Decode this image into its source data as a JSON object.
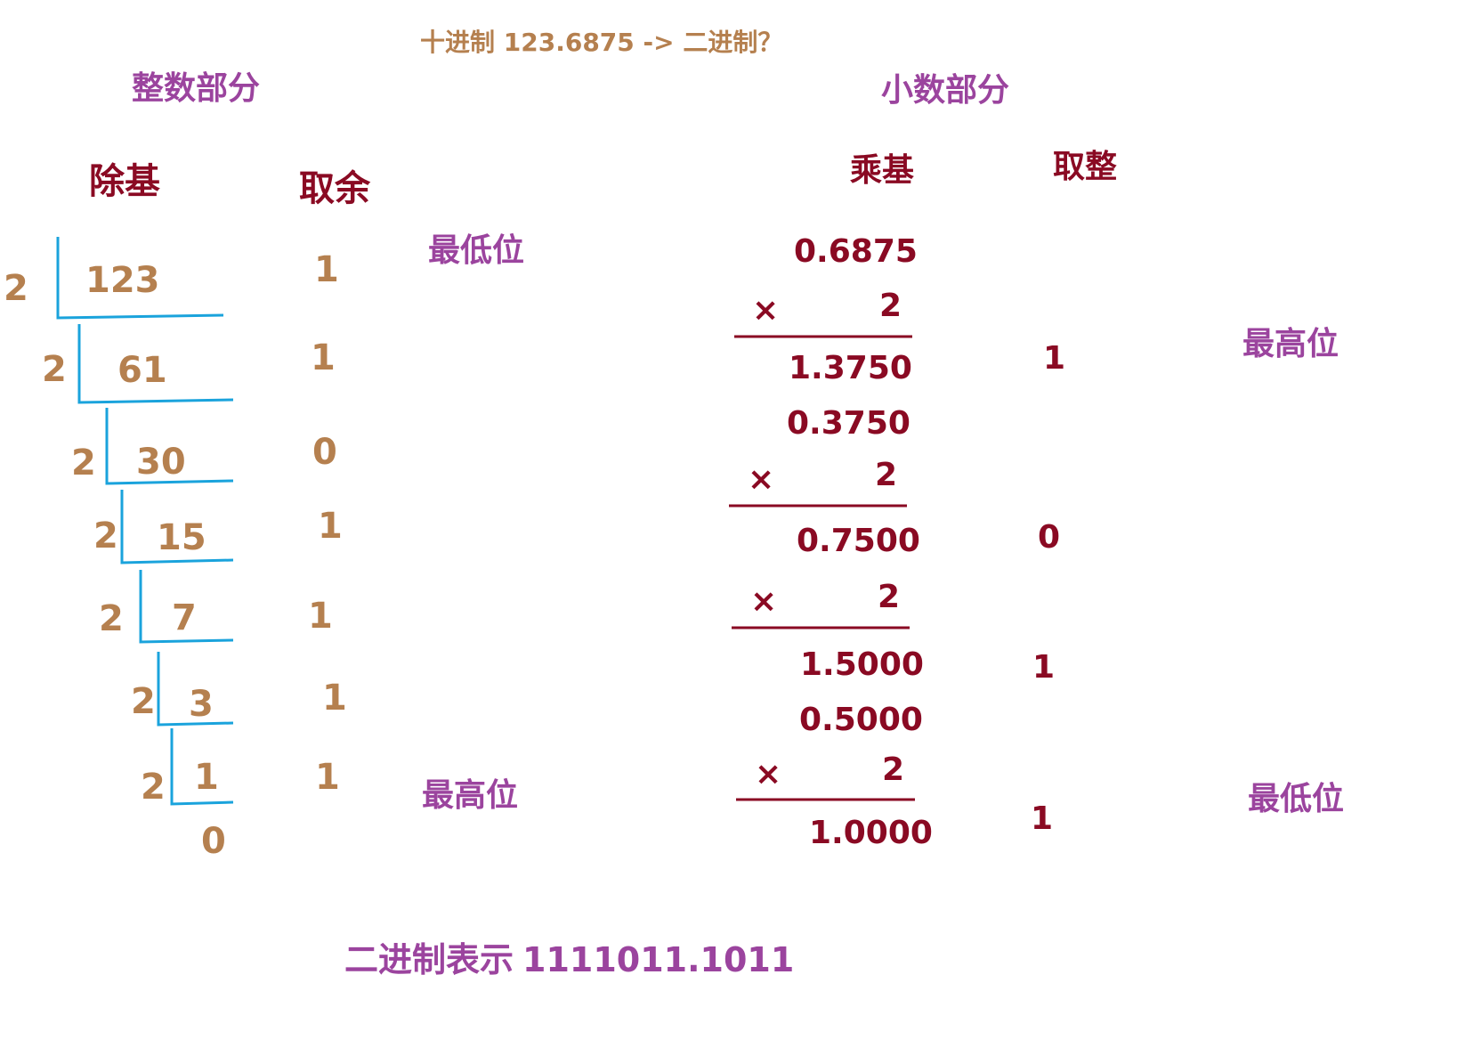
{
  "title": "十进制 123.6875 -> 二进制？",
  "integer_part": {
    "heading": "整数部分",
    "col_divide": "除基",
    "col_remainder": "取余",
    "steps": [
      {
        "divisor": "2",
        "dividend": "123",
        "remainder": "1"
      },
      {
        "divisor": "2",
        "dividend": "61",
        "remainder": "1"
      },
      {
        "divisor": "2",
        "dividend": "30",
        "remainder": "0"
      },
      {
        "divisor": "2",
        "dividend": "15",
        "remainder": "1"
      },
      {
        "divisor": "2",
        "dividend": "7",
        "remainder": "1"
      },
      {
        "divisor": "2",
        "dividend": "3",
        "remainder": "1"
      },
      {
        "divisor": "2",
        "dividend": "1",
        "remainder": "1"
      }
    ],
    "final_quotient": "0",
    "lowest_label": "最低位",
    "highest_label": "最高位"
  },
  "fraction_part": {
    "heading": "小数部分",
    "col_multiply": "乘基",
    "col_integer": "取整",
    "times_symbol": "×",
    "multiplier": "2",
    "steps": [
      {
        "multiplicand": "0.6875",
        "product": "1.3750",
        "digit": "1"
      },
      {
        "multiplicand": "0.3750",
        "product": "0.7500",
        "digit": "0"
      },
      {
        "multiplicand": "",
        "product": "1.5000",
        "digit": "1"
      },
      {
        "multiplicand": "0.5000",
        "product": "1.0000",
        "digit": "1"
      }
    ],
    "highest_label": "最高位",
    "lowest_label": "最低位"
  },
  "binary_result": {
    "label": "二进制表示",
    "value": "1111011.1011"
  },
  "colors": {
    "tan": "#b5804f",
    "purple": "#9b449e",
    "dark_red": "#8a0a23",
    "blue_lines": "#1aa3dc"
  }
}
